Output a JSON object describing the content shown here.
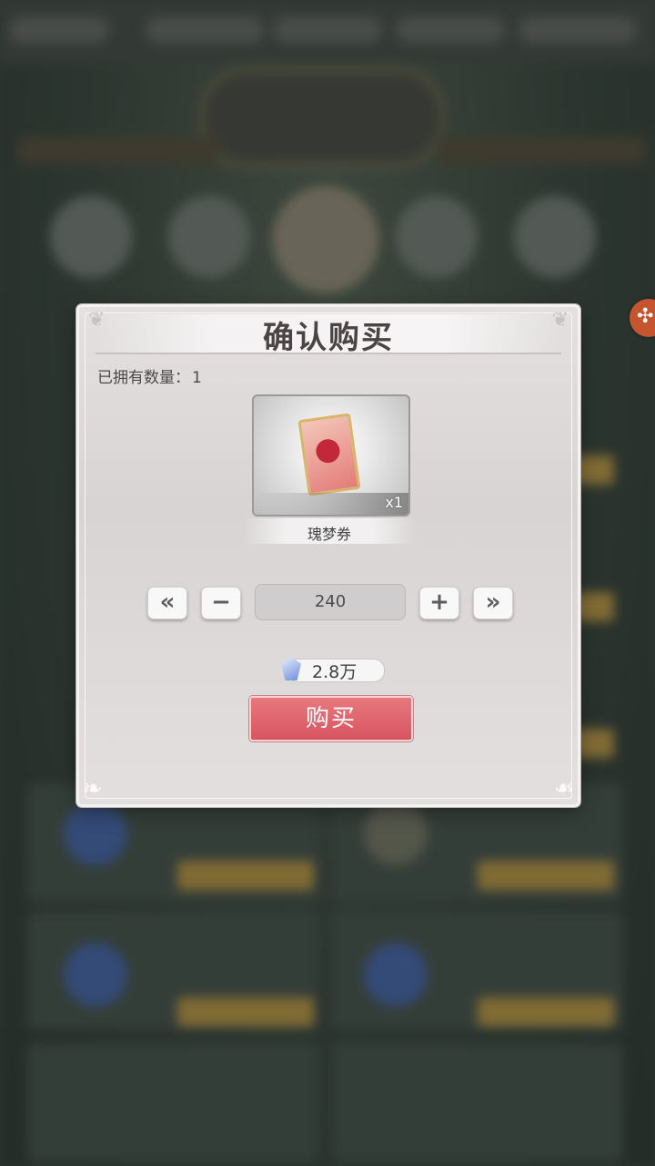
{
  "dialog": {
    "title": "确认购买",
    "owned_label": "已拥有数量：",
    "owned_count": "1"
  },
  "item": {
    "name": "瑰梦券",
    "quantity_badge": "x1"
  },
  "quantity": {
    "value": "240",
    "min_label": "«",
    "minus_label": "−",
    "plus_label": "+",
    "max_label": "»"
  },
  "price": {
    "amount": "2.8万",
    "currency_icon": "crystal-gem-icon"
  },
  "buy_button": {
    "label": "购买"
  },
  "colors": {
    "buy_button": "#d85560",
    "dialog_bg": "#e0dcdc"
  }
}
